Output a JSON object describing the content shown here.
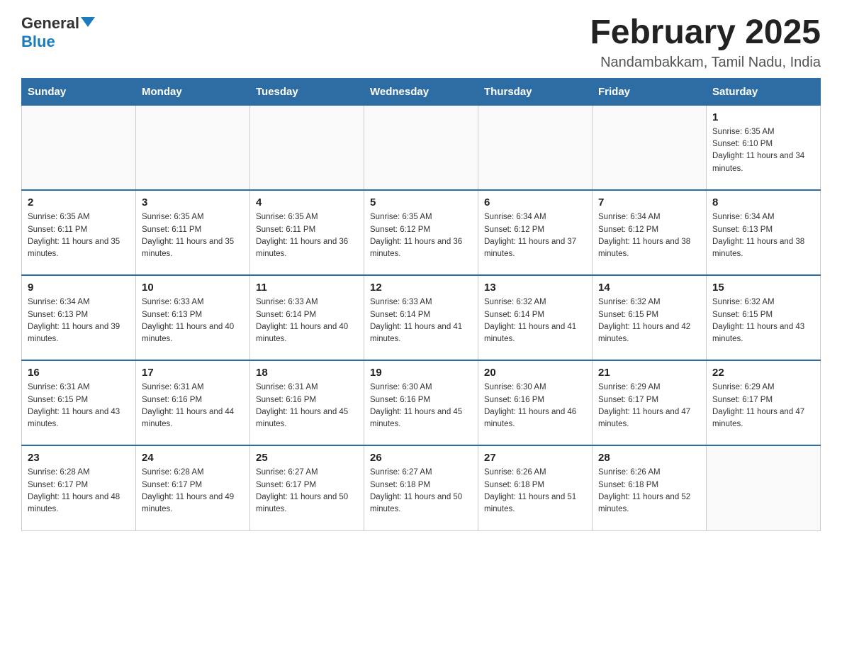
{
  "logo": {
    "general": "General",
    "blue": "Blue"
  },
  "title": "February 2025",
  "location": "Nandambakkam, Tamil Nadu, India",
  "days_of_week": [
    "Sunday",
    "Monday",
    "Tuesday",
    "Wednesday",
    "Thursday",
    "Friday",
    "Saturday"
  ],
  "weeks": [
    [
      {
        "day": "",
        "info": ""
      },
      {
        "day": "",
        "info": ""
      },
      {
        "day": "",
        "info": ""
      },
      {
        "day": "",
        "info": ""
      },
      {
        "day": "",
        "info": ""
      },
      {
        "day": "",
        "info": ""
      },
      {
        "day": "1",
        "info": "Sunrise: 6:35 AM\nSunset: 6:10 PM\nDaylight: 11 hours and 34 minutes."
      }
    ],
    [
      {
        "day": "2",
        "info": "Sunrise: 6:35 AM\nSunset: 6:11 PM\nDaylight: 11 hours and 35 minutes."
      },
      {
        "day": "3",
        "info": "Sunrise: 6:35 AM\nSunset: 6:11 PM\nDaylight: 11 hours and 35 minutes."
      },
      {
        "day": "4",
        "info": "Sunrise: 6:35 AM\nSunset: 6:11 PM\nDaylight: 11 hours and 36 minutes."
      },
      {
        "day": "5",
        "info": "Sunrise: 6:35 AM\nSunset: 6:12 PM\nDaylight: 11 hours and 36 minutes."
      },
      {
        "day": "6",
        "info": "Sunrise: 6:34 AM\nSunset: 6:12 PM\nDaylight: 11 hours and 37 minutes."
      },
      {
        "day": "7",
        "info": "Sunrise: 6:34 AM\nSunset: 6:12 PM\nDaylight: 11 hours and 38 minutes."
      },
      {
        "day": "8",
        "info": "Sunrise: 6:34 AM\nSunset: 6:13 PM\nDaylight: 11 hours and 38 minutes."
      }
    ],
    [
      {
        "day": "9",
        "info": "Sunrise: 6:34 AM\nSunset: 6:13 PM\nDaylight: 11 hours and 39 minutes."
      },
      {
        "day": "10",
        "info": "Sunrise: 6:33 AM\nSunset: 6:13 PM\nDaylight: 11 hours and 40 minutes."
      },
      {
        "day": "11",
        "info": "Sunrise: 6:33 AM\nSunset: 6:14 PM\nDaylight: 11 hours and 40 minutes."
      },
      {
        "day": "12",
        "info": "Sunrise: 6:33 AM\nSunset: 6:14 PM\nDaylight: 11 hours and 41 minutes."
      },
      {
        "day": "13",
        "info": "Sunrise: 6:32 AM\nSunset: 6:14 PM\nDaylight: 11 hours and 41 minutes."
      },
      {
        "day": "14",
        "info": "Sunrise: 6:32 AM\nSunset: 6:15 PM\nDaylight: 11 hours and 42 minutes."
      },
      {
        "day": "15",
        "info": "Sunrise: 6:32 AM\nSunset: 6:15 PM\nDaylight: 11 hours and 43 minutes."
      }
    ],
    [
      {
        "day": "16",
        "info": "Sunrise: 6:31 AM\nSunset: 6:15 PM\nDaylight: 11 hours and 43 minutes."
      },
      {
        "day": "17",
        "info": "Sunrise: 6:31 AM\nSunset: 6:16 PM\nDaylight: 11 hours and 44 minutes."
      },
      {
        "day": "18",
        "info": "Sunrise: 6:31 AM\nSunset: 6:16 PM\nDaylight: 11 hours and 45 minutes."
      },
      {
        "day": "19",
        "info": "Sunrise: 6:30 AM\nSunset: 6:16 PM\nDaylight: 11 hours and 45 minutes."
      },
      {
        "day": "20",
        "info": "Sunrise: 6:30 AM\nSunset: 6:16 PM\nDaylight: 11 hours and 46 minutes."
      },
      {
        "day": "21",
        "info": "Sunrise: 6:29 AM\nSunset: 6:17 PM\nDaylight: 11 hours and 47 minutes."
      },
      {
        "day": "22",
        "info": "Sunrise: 6:29 AM\nSunset: 6:17 PM\nDaylight: 11 hours and 47 minutes."
      }
    ],
    [
      {
        "day": "23",
        "info": "Sunrise: 6:28 AM\nSunset: 6:17 PM\nDaylight: 11 hours and 48 minutes."
      },
      {
        "day": "24",
        "info": "Sunrise: 6:28 AM\nSunset: 6:17 PM\nDaylight: 11 hours and 49 minutes."
      },
      {
        "day": "25",
        "info": "Sunrise: 6:27 AM\nSunset: 6:17 PM\nDaylight: 11 hours and 50 minutes."
      },
      {
        "day": "26",
        "info": "Sunrise: 6:27 AM\nSunset: 6:18 PM\nDaylight: 11 hours and 50 minutes."
      },
      {
        "day": "27",
        "info": "Sunrise: 6:26 AM\nSunset: 6:18 PM\nDaylight: 11 hours and 51 minutes."
      },
      {
        "day": "28",
        "info": "Sunrise: 6:26 AM\nSunset: 6:18 PM\nDaylight: 11 hours and 52 minutes."
      },
      {
        "day": "",
        "info": ""
      }
    ]
  ]
}
